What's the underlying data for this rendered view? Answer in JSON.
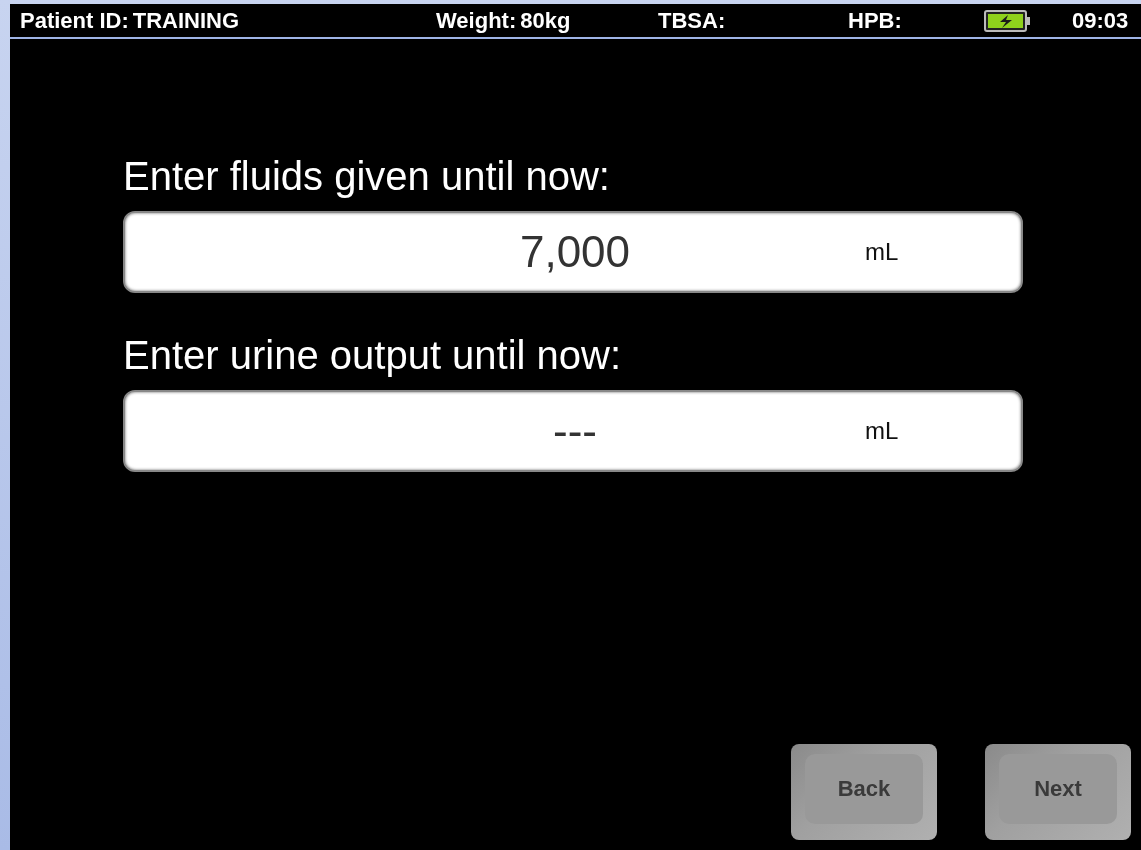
{
  "status_bar": {
    "patient_id_label": "Patient ID:",
    "patient_id": "TRAINING",
    "weight_label": "Weight:",
    "weight": "80kg",
    "tbsa_label": "TBSA:",
    "hpb_label": "HPB:",
    "time": "09:03"
  },
  "fields": [
    {
      "label": "Enter fluids given until now:",
      "value": "7,000",
      "unit": "mL"
    },
    {
      "label": "Enter urine output until now:",
      "value": "---",
      "unit": "mL"
    }
  ],
  "buttons": [
    "Back",
    "Next"
  ]
}
